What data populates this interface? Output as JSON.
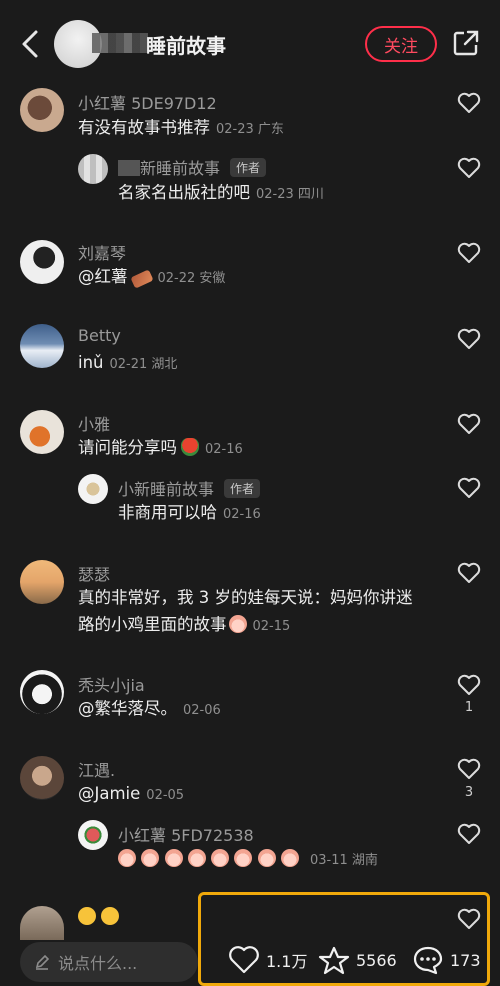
{
  "header": {
    "title": "睡前故事",
    "follow_label": "关注"
  },
  "comments": [
    {
      "name": "小红薯 5DE97D12",
      "text": "有没有故事书推荐",
      "meta": "02-23 广东"
    },
    {
      "name": "新睡前故事",
      "tag": "作者",
      "text": "名家名出版社的吧",
      "meta": "02-23 四川"
    },
    {
      "name": "刘嘉琴",
      "text": "@红薯",
      "meta": "02-22 安徽"
    },
    {
      "name": "Betty",
      "text": "inǔ",
      "meta": "02-21 湖北"
    },
    {
      "name": "小雅",
      "text": "请问能分享吗",
      "meta": "02-16"
    },
    {
      "name": "小新睡前故事",
      "tag": "作者",
      "text": "非商用可以哈",
      "meta": "02-16"
    },
    {
      "name": "瑟瑟",
      "text_line1": "真的非常好，我 3 岁的娃每天说：妈妈你讲迷",
      "text_line2": "路的小鸡里面的故事",
      "meta": "02-15"
    },
    {
      "name": "秃头小jia",
      "text": "@繁华落尽。",
      "meta": "02-06",
      "likes": "1"
    },
    {
      "name": "江遇.",
      "text": "@Jamie",
      "meta": "02-05",
      "likes": "3"
    },
    {
      "name": "小红薯 5FD72538",
      "meta": "03-11 湖南"
    }
  ],
  "bottom": {
    "input_placeholder": "说点什么...",
    "likes": "1.1万",
    "stars": "5566",
    "comments": "173"
  }
}
